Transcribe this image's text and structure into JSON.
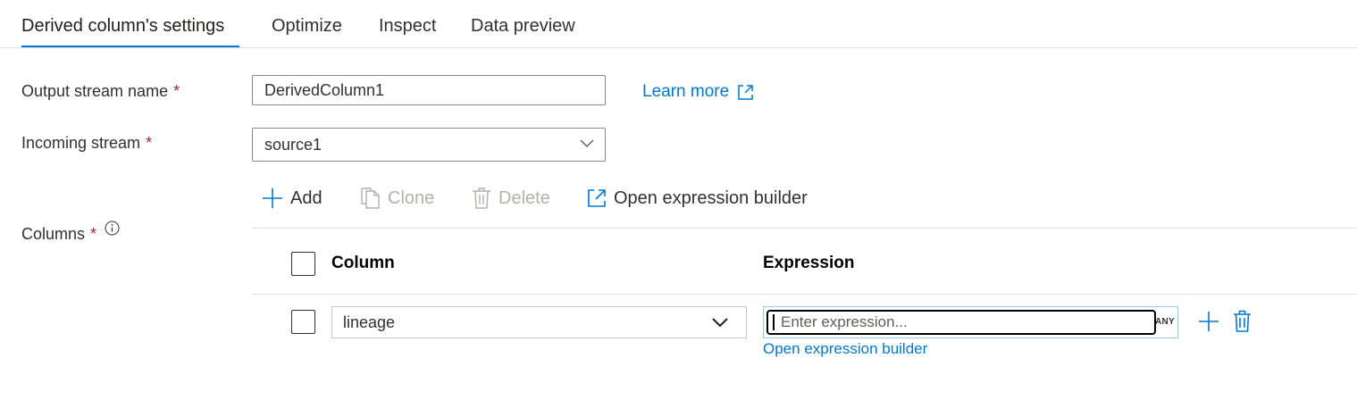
{
  "tabs": [
    {
      "label": "Derived column's settings",
      "active": true
    },
    {
      "label": "Optimize",
      "active": false
    },
    {
      "label": "Inspect",
      "active": false
    },
    {
      "label": "Data preview",
      "active": false
    }
  ],
  "form": {
    "output_stream_label": "Output stream name",
    "output_stream_value": "DerivedColumn1",
    "incoming_stream_label": "Incoming stream",
    "incoming_stream_value": "source1",
    "columns_label": "Columns",
    "required_mark": "*",
    "learn_more": "Learn more"
  },
  "toolbar": {
    "add": "Add",
    "clone": "Clone",
    "delete": "Delete",
    "open_builder": "Open expression builder"
  },
  "grid": {
    "headers": {
      "column": "Column",
      "expression": "Expression"
    },
    "rows": [
      {
        "column": "lineage",
        "expression_placeholder": "Enter expression...",
        "type_badge": "ANY",
        "open_builder_link": "Open expression builder"
      }
    ]
  },
  "colors": {
    "accent": "#0078d4",
    "required": "#a4262c",
    "disabled": "#b3b0ad"
  }
}
